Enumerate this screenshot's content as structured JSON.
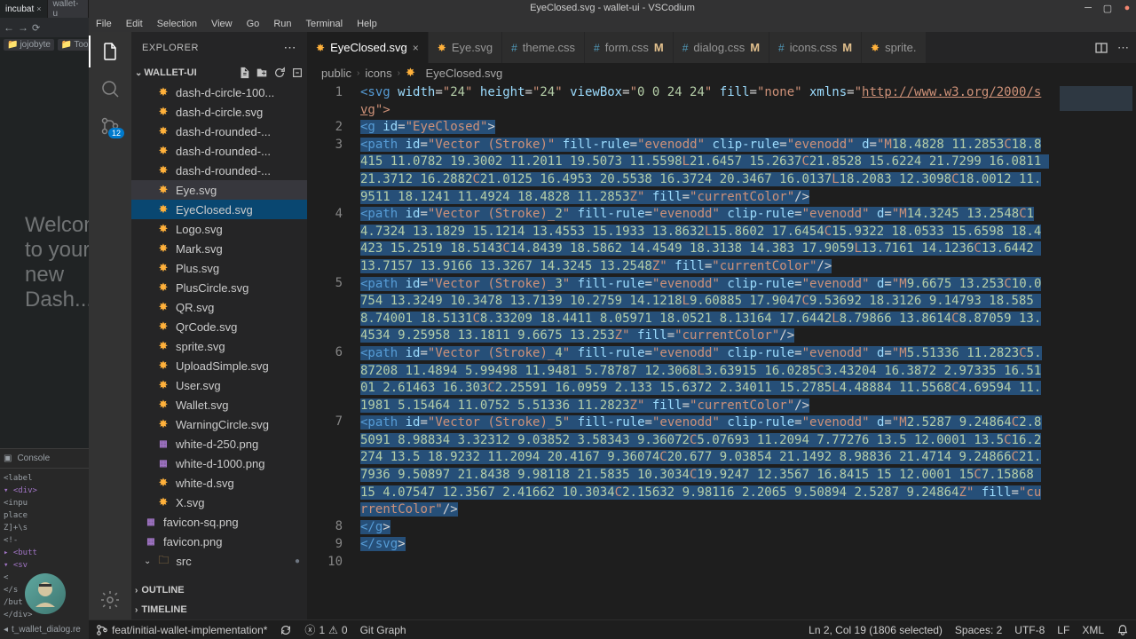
{
  "browser": {
    "tabs": [
      "incubat",
      "wallet-u"
    ],
    "bookmarks": [
      "jojobyte",
      "Tools"
    ],
    "welcome": "Welcome to your new Dash...",
    "devtools_tab": "Console",
    "code_lines": [
      "<label",
      "  <div>",
      "  <inpu",
      "  place",
      "  Z]+\\s",
      "  <!-",
      "<butt",
      "  <sv",
      "  <",
      "  </s",
      "  /but",
      "  </div>"
    ],
    "footer": "t_wallet_dialog.re"
  },
  "vscode": {
    "title": "EyeClosed.svg - wallet-ui - VSCodium",
    "menus": [
      "File",
      "Edit",
      "Selection",
      "View",
      "Go",
      "Run",
      "Terminal",
      "Help"
    ],
    "activity_badge": "12",
    "sidebar": {
      "title": "EXPLORER",
      "folder": "WALLET-UI",
      "files": [
        {
          "name": "dash-d-circle-100...",
          "icon": "svg"
        },
        {
          "name": "dash-d-circle.svg",
          "icon": "svg"
        },
        {
          "name": "dash-d-rounded-...",
          "icon": "svg"
        },
        {
          "name": "dash-d-rounded-...",
          "icon": "svg"
        },
        {
          "name": "dash-d-rounded-...",
          "icon": "svg"
        },
        {
          "name": "Eye.svg",
          "icon": "svg",
          "hl": true
        },
        {
          "name": "EyeClosed.svg",
          "icon": "svg",
          "selected": true
        },
        {
          "name": "Logo.svg",
          "icon": "svg"
        },
        {
          "name": "Mark.svg",
          "icon": "svg"
        },
        {
          "name": "Plus.svg",
          "icon": "svg"
        },
        {
          "name": "PlusCircle.svg",
          "icon": "svg"
        },
        {
          "name": "QR.svg",
          "icon": "svg"
        },
        {
          "name": "QrCode.svg",
          "icon": "svg"
        },
        {
          "name": "sprite.svg",
          "icon": "svg"
        },
        {
          "name": "UploadSimple.svg",
          "icon": "svg"
        },
        {
          "name": "User.svg",
          "icon": "svg"
        },
        {
          "name": "Wallet.svg",
          "icon": "svg"
        },
        {
          "name": "WarningCircle.svg",
          "icon": "svg"
        },
        {
          "name": "white-d-250.png",
          "icon": "png"
        },
        {
          "name": "white-d-1000.png",
          "icon": "png"
        },
        {
          "name": "white-d.svg",
          "icon": "svg"
        },
        {
          "name": "X.svg",
          "icon": "svg"
        },
        {
          "name": "favicon-sq.png",
          "icon": "png",
          "indent": -14
        },
        {
          "name": "favicon.png",
          "icon": "png",
          "indent": -14
        }
      ],
      "src_folder": "src",
      "outline": "OUTLINE",
      "timeline": "TIMELINE"
    },
    "tabs": [
      {
        "label": "EyeClosed.svg",
        "icon": "svg",
        "active": true,
        "close": true
      },
      {
        "label": "Eye.svg",
        "icon": "svg"
      },
      {
        "label": "theme.css",
        "icon": "css"
      },
      {
        "label": "form.css",
        "icon": "css",
        "modified": "M"
      },
      {
        "label": "dialog.css",
        "icon": "css",
        "modified": "M"
      },
      {
        "label": "icons.css",
        "icon": "css",
        "modified": "M"
      },
      {
        "label": "sprite.",
        "icon": "svg"
      }
    ],
    "breadcrumbs": [
      "public",
      "icons",
      "EyeClosed.svg"
    ],
    "line_numbers": [
      "1",
      "2",
      "3",
      "4",
      "5",
      "6",
      "7",
      "8",
      "9",
      "10"
    ],
    "code": {
      "l1": {
        "pre": "<svg",
        "attrs": " width=\"24\" height=\"24\" viewBox=\"0 0 24 24\" fill=\"none\" xmlns=\"",
        "link": "http://www.w3.org/2000/svg",
        "post": "\">"
      },
      "l2": "<g id=\"EyeClosed\">",
      "l3": "<path id=\"Vector (Stroke)\" fill-rule=\"evenodd\" clip-rule=\"evenodd\" d=\"M18.4828 11.2853C18.8415 11.0782 19.3002 11.2011 19.5073 11.5598L21.6457 15.2637C21.8528 15.6224 21.7299 16.0811 21.3712 16.2882C21.0125 16.4953 20.5538 16.3724 20.3467 16.0137L18.2083 12.3098C18.0012 11.9511 18.1241 11.4924 18.4828 11.2853Z\" fill=\"currentColor\"/>",
      "l4": "<path id=\"Vector (Stroke)_2\" fill-rule=\"evenodd\" clip-rule=\"evenodd\" d=\"M14.3245 13.2548C14.7324 13.1829 15.1214 13.4553 15.1933 13.8632L15.8602 17.6454C15.9322 18.0533 15.6598 18.4423 15.2519 18.5143C14.8439 18.5862 14.4549 18.3138 14.383 17.9059L13.7161 14.1236C13.6442 13.7157 13.9166 13.3267 14.3245 13.2548Z\" fill=\"currentColor\"/>",
      "l5": "<path id=\"Vector (Stroke)_3\" fill-rule=\"evenodd\" clip-rule=\"evenodd\" d=\"M9.6675 13.253C10.0754 13.3249 10.3478 13.7139 10.2759 14.1218L9.60885 17.9047C9.53692 18.3126 9.14793 18.585 8.74001 18.5131C8.33209 18.4411 8.05971 18.0521 8.13164 17.6442L8.79866 13.8614C8.87059 13.4534 9.25958 13.1811 9.6675 13.253Z\" fill=\"currentColor\"/>",
      "l6": "<path id=\"Vector (Stroke)_4\" fill-rule=\"evenodd\" clip-rule=\"evenodd\" d=\"M5.51336 11.2823C5.87208 11.4894 5.99498 11.9481 5.78787 12.3068L3.63915 16.0285C3.43204 16.3872 2.97335 16.5101 2.61463 16.303C2.25591 16.0959 2.133 15.6372 2.34011 15.2785L4.48884 11.5568C4.69594 11.1981 5.15464 11.0752 5.51336 11.2823Z\" fill=\"currentColor\"/>",
      "l7": "<path id=\"Vector (Stroke)_5\" fill-rule=\"evenodd\" clip-rule=\"evenodd\" d=\"M2.5287 9.24864C2.85091 8.98834 3.32312 9.03852 3.58343 9.36072C5.07693 11.2094 7.77276 13.5 12.0001 13.5C16.2274 13.5 18.9232 11.2094 20.4167 9.36074C20.677 9.03854 21.1492 8.98836 21.4714 9.24866C21.7936 9.50897 21.8438 9.98118 21.5835 10.3034C19.9247 12.3567 16.8415 15 12.0001 15C7.15868 15 4.07547 12.3567 2.41662 10.3034C2.15632 9.98116 2.2065 9.50894 2.5287 9.24864Z\" fill=\"currentColor\"/>",
      "l8": "</g>",
      "l9": "</svg>"
    },
    "status": {
      "branch": "feat/initial-wallet-implementation*",
      "errors": "1",
      "warnings": "0",
      "gitgraph": "Git Graph",
      "selection": "Ln 2, Col 19 (1806 selected)",
      "spaces": "Spaces: 2",
      "encoding": "UTF-8",
      "eol": "LF",
      "lang": "XML"
    }
  }
}
